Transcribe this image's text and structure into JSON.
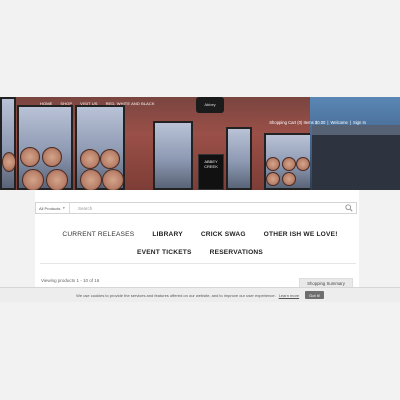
{
  "nav": {
    "items": [
      "HOME",
      "SHOP",
      "VISIT US",
      "RED, WHITE AND BLACK"
    ]
  },
  "hero": {
    "sign_text": "Abbey",
    "door_text": "ABBEY CREEK"
  },
  "cart": {
    "summary": "Shopping Cart (0) Items $0.00",
    "separator": "|",
    "welcome": "Welcome",
    "sign_in": "Sign In"
  },
  "search": {
    "category": "All Products",
    "placeholder": "Search"
  },
  "menu": {
    "row1": [
      "CURRENT RELEASES",
      "LIBRARY",
      "CRICK SWAG",
      "OTHER ISH WE LOVE!"
    ],
    "row2": [
      "EVENT TICKETS",
      "RESERVATIONS"
    ]
  },
  "products": {
    "viewing": "Viewing products 1 - 10 of 16",
    "shopping_summary": "Shopping Summary"
  },
  "cookie": {
    "text": "We use cookies to provide the services and features offered on our website, and to improve our user experience.",
    "learn_more": "Learn more",
    "button": "Got it!"
  }
}
